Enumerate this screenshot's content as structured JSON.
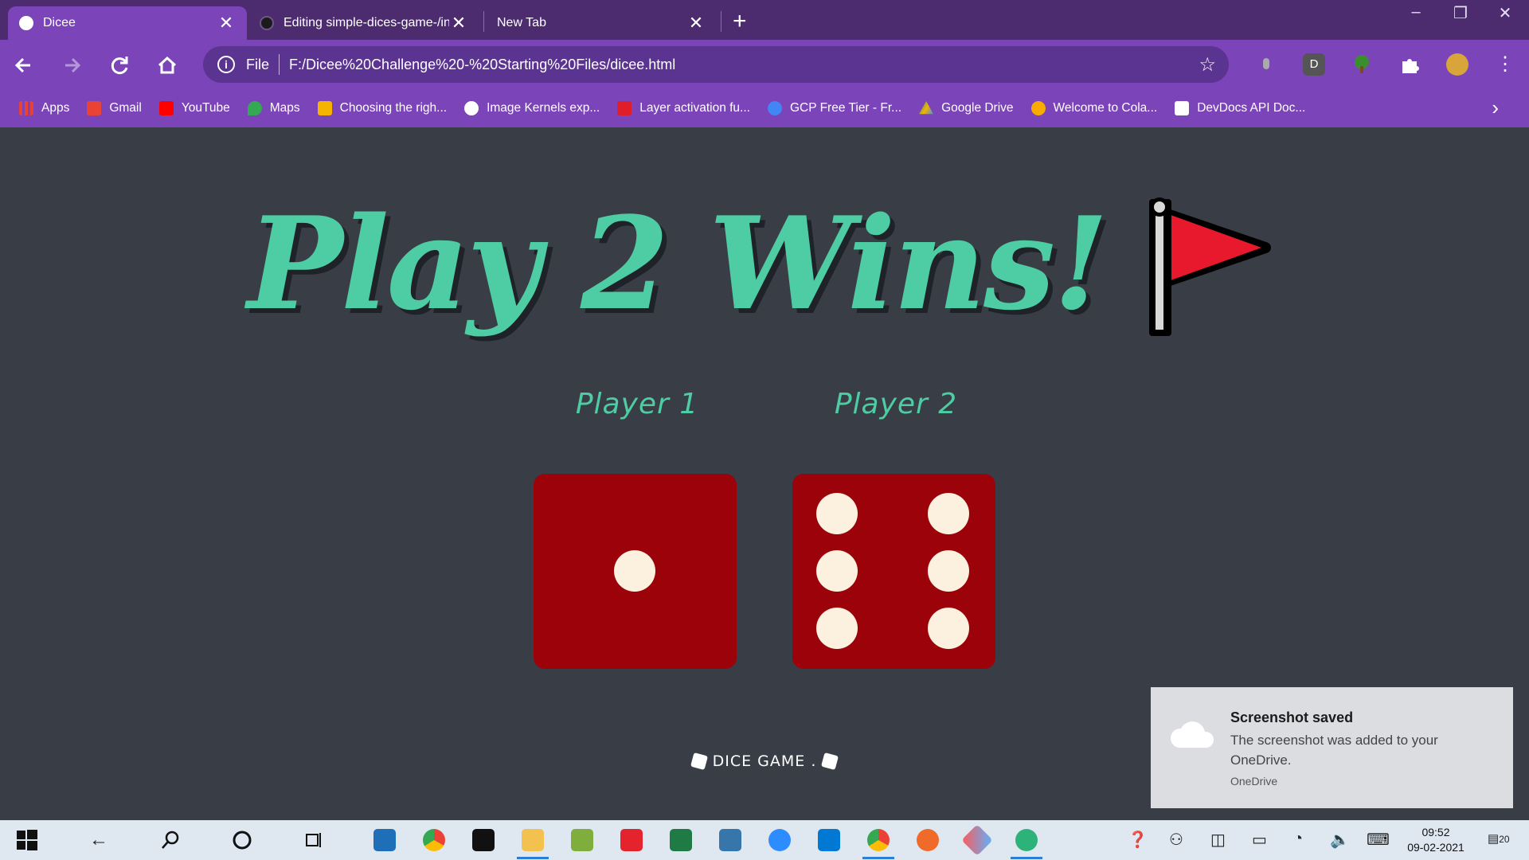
{
  "browser": {
    "tabs": [
      {
        "title": "Dicee",
        "active": true
      },
      {
        "title": "Editing simple-dices-game-/in",
        "active": false
      },
      {
        "title": "New Tab",
        "active": false
      }
    ],
    "new_tab_symbol": "+",
    "window_controls": {
      "minimize": "–",
      "restore": "❐",
      "close": "✕"
    },
    "address": {
      "scheme_label": "File",
      "url": "F:/Dicee%20Challenge%20-%20Starting%20Files/dicee.html"
    },
    "extension_letter": "D",
    "bookmarks": [
      {
        "label": "Apps",
        "icon": "apps-grid-icon",
        "color": "#e94235"
      },
      {
        "label": "Gmail",
        "icon": "gmail-icon",
        "color": "#ea4335"
      },
      {
        "label": "YouTube",
        "icon": "youtube-icon",
        "color": "#ff0000"
      },
      {
        "label": "Maps",
        "icon": "maps-icon",
        "color": "#34a853"
      },
      {
        "label": "Choosing the righ...",
        "icon": "page-icon",
        "color": "#f4b400"
      },
      {
        "label": "Image Kernels exp...",
        "icon": "github-icon",
        "color": "#ffffff"
      },
      {
        "label": "Layer activation fu...",
        "icon": "k-icon",
        "color": "#e01e2b"
      },
      {
        "label": "GCP Free Tier - Fr...",
        "icon": "gcp-icon",
        "color": "#4285f4"
      },
      {
        "label": "Google Drive",
        "icon": "drive-icon",
        "color": "#0f9d58"
      },
      {
        "label": "Welcome to Cola...",
        "icon": "colab-icon",
        "color": "#f9ab00"
      },
      {
        "label": "DevDocs API Doc...",
        "icon": "devdocs-icon",
        "color": "#ffffff"
      }
    ]
  },
  "page": {
    "title": "Play 2 Wins!",
    "players": [
      {
        "label": "Player 1",
        "die_value": 1
      },
      {
        "label": "Player 2",
        "die_value": 6
      }
    ],
    "footer": "DICE GAME ."
  },
  "toast": {
    "title": "Screenshot saved",
    "body": "The screenshot was added to your OneDrive.",
    "source": "OneDrive"
  },
  "taskbar": {
    "time": "09:52",
    "date": "09-02-2021",
    "notification_count": "20"
  },
  "colors": {
    "accent": "#4ecca3",
    "page_bg": "#393e46",
    "die": "#9b0209",
    "pip": "#fbf1de",
    "chrome_tabbar": "#4c2b6e",
    "chrome_toolbar": "#7b44b8",
    "flag_red": "#e8192c"
  }
}
